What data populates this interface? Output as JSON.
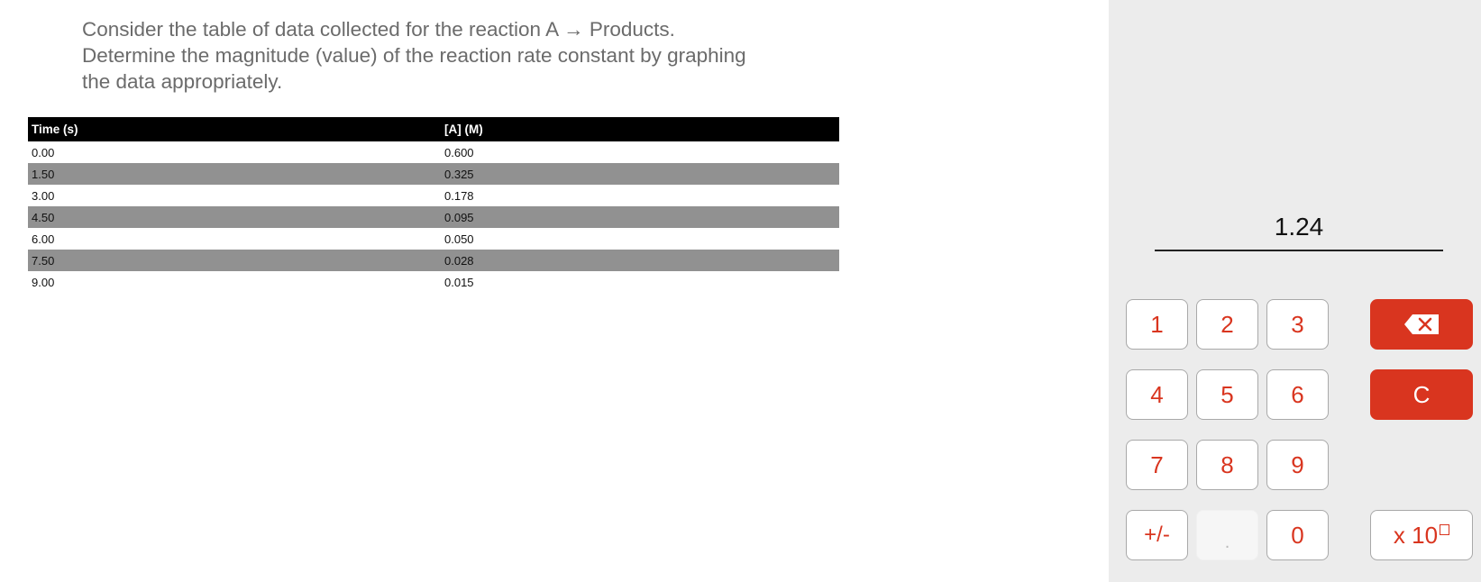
{
  "question": {
    "text": "Consider the table of data collected for the reaction A → Products. Determine the magnitude (value) of the reaction rate constant by graphing the data appropriately."
  },
  "table": {
    "headers": [
      "Time (s)",
      "[A] (M)"
    ],
    "rows": [
      [
        "0.00",
        "0.600"
      ],
      [
        "1.50",
        "0.325"
      ],
      [
        "3.00",
        "0.178"
      ],
      [
        "4.50",
        "0.095"
      ],
      [
        "6.00",
        "0.050"
      ],
      [
        "7.50",
        "0.028"
      ],
      [
        "9.00",
        "0.015"
      ]
    ]
  },
  "calculator": {
    "display_value": "1.24",
    "keys": {
      "one": "1",
      "two": "2",
      "three": "3",
      "four": "4",
      "five": "5",
      "six": "6",
      "seven": "7",
      "eight": "8",
      "nine": "9",
      "sign": "+/-",
      "decimal": ".",
      "zero": "0",
      "clear": "C",
      "exponent_prefix": "x 10",
      "backspace_icon": "backspace-icon",
      "exponent_box_icon": "exponent-box-icon"
    },
    "colors": {
      "accent": "#d9351f",
      "panel_bg": "#ececec"
    }
  }
}
